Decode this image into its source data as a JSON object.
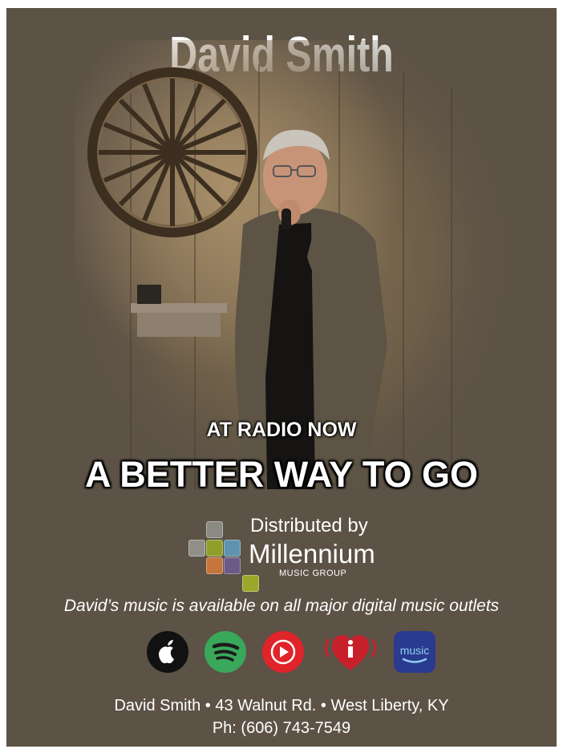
{
  "poster": {
    "artist_name": "David Smith",
    "headline_small": "AT RADIO NOW",
    "headline_big": "A BETTER WAY TO GO",
    "distributor": {
      "prefix": "Distributed by",
      "name": "Millennium",
      "sub": "MUSIC GROUP"
    },
    "availability": "David’s music is available on all major digital music outlets",
    "platform_icons": [
      "apple-music-icon",
      "spotify-icon",
      "youtube-music-icon",
      "iheartradio-icon",
      "amazon-music-icon"
    ],
    "amazon_label": "music",
    "contact": {
      "line1": "David Smith • 43 Walnut Rd. • West Liberty, KY",
      "line2": "Ph: (606) 743-7549"
    }
  },
  "colors": {
    "background": "#5c5246",
    "text": "#ffffff",
    "spotify": "#3aa85a",
    "youtube": "#e0242a",
    "iheart": "#c8202a",
    "amazon": "#2a3b8f"
  }
}
